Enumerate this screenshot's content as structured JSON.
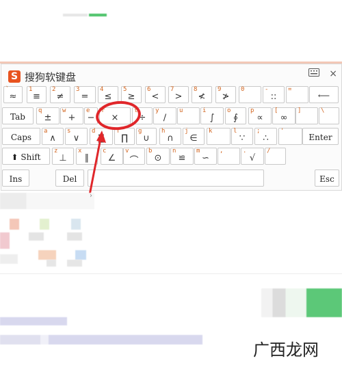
{
  "keyboard": {
    "title": "搜狗软键盘",
    "logo": "S",
    "icons": [
      "keyboard-icon",
      "close-icon"
    ],
    "close_glyph": "×",
    "row1": [
      {
        "sub": "`",
        "main": "≈"
      },
      {
        "sub": "1",
        "main": "≡"
      },
      {
        "sub": "2",
        "main": "≠"
      },
      {
        "sub": "3",
        "main": "="
      },
      {
        "sub": "4",
        "main": "≤"
      },
      {
        "sub": "5",
        "main": "≥"
      },
      {
        "sub": "6",
        "main": "<"
      },
      {
        "sub": "7",
        "main": ">"
      },
      {
        "sub": "8",
        "main": "≮"
      },
      {
        "sub": "9",
        "main": "≯"
      },
      {
        "sub": "0",
        "main": ""
      },
      {
        "sub": "-",
        "main": "::"
      },
      {
        "sub": "=",
        "main": ""
      },
      {
        "sub": "",
        "main": "⟵"
      }
    ],
    "row2": [
      {
        "sub": "",
        "main": "Tab"
      },
      {
        "sub": "q",
        "main": "±"
      },
      {
        "sub": "w",
        "main": "+"
      },
      {
        "sub": "e",
        "main": "−"
      },
      {
        "sub": "r",
        "main": "×"
      },
      {
        "sub": "t",
        "main": "÷"
      },
      {
        "sub": "y",
        "main": "∕"
      },
      {
        "sub": "u",
        "main": ""
      },
      {
        "sub": "i",
        "main": "∫"
      },
      {
        "sub": "o",
        "main": "∮"
      },
      {
        "sub": "p",
        "main": "∝"
      },
      {
        "sub": "[",
        "main": "∞"
      },
      {
        "sub": "]",
        "main": ""
      },
      {
        "sub": "\\",
        "main": ""
      }
    ],
    "row3": [
      {
        "sub": "",
        "main": "Caps"
      },
      {
        "sub": "a",
        "main": "∧"
      },
      {
        "sub": "s",
        "main": "∨"
      },
      {
        "sub": "d",
        "main": "∑"
      },
      {
        "sub": "f",
        "main": "∏"
      },
      {
        "sub": "g",
        "main": "∪"
      },
      {
        "sub": "h",
        "main": "∩"
      },
      {
        "sub": "j",
        "main": "∈"
      },
      {
        "sub": "k",
        "main": ""
      },
      {
        "sub": "l",
        "main": "∵"
      },
      {
        "sub": ";",
        "main": "∴"
      },
      {
        "sub": "'",
        "main": ""
      },
      {
        "sub": "",
        "main": "Enter"
      }
    ],
    "row4": [
      {
        "sub": "",
        "main": "⬆ Shift"
      },
      {
        "sub": "z",
        "main": "⊥"
      },
      {
        "sub": "x",
        "main": "∥"
      },
      {
        "sub": "c",
        "main": "∠"
      },
      {
        "sub": "v",
        "main": "⌒"
      },
      {
        "sub": "b",
        "main": "⊙"
      },
      {
        "sub": "n",
        "main": "≌"
      },
      {
        "sub": "m",
        "main": "∽"
      },
      {
        "sub": ",",
        "main": ""
      },
      {
        "sub": ".",
        "main": "√"
      },
      {
        "sub": "/",
        "main": ""
      }
    ],
    "row5": [
      {
        "sub": "",
        "main": "Ins"
      },
      {
        "sub": "",
        "main": "Del"
      },
      {
        "sub": "",
        "main": ""
      },
      {
        "sub": "",
        "main": "Esc"
      }
    ]
  },
  "page": {
    "watermark": "广西龙网",
    "chevron": "›",
    "annotation_color": "#e0262a"
  }
}
